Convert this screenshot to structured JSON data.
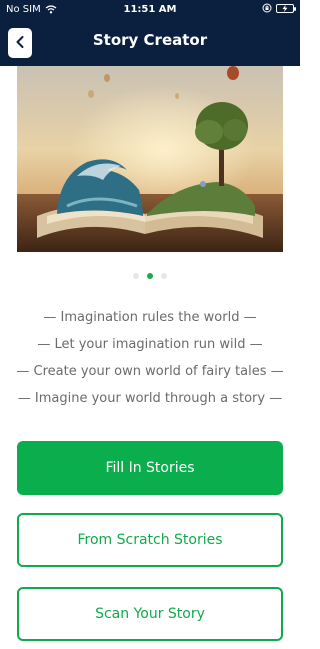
{
  "status_bar": {
    "carrier": "No SIM",
    "time": "11:51 AM"
  },
  "header": {
    "title": "Story Creator",
    "back_icon": "chevron-left-icon"
  },
  "carousel": {
    "slide_count": 3,
    "active_index": 1
  },
  "taglines": [
    "— Imagination rules the world —",
    "— Let your imagination run wild —",
    "— Create your own world of fairy tales —",
    "— Imagine your world through a story —"
  ],
  "buttons": {
    "fill_in": "Fill In Stories",
    "from_scratch": "From Scratch Stories",
    "scan": "Scan Your Story"
  },
  "colors": {
    "header_bg": "#0b1f3f",
    "primary_green": "#0aae4c",
    "tagline_text": "#6b6b6b"
  }
}
